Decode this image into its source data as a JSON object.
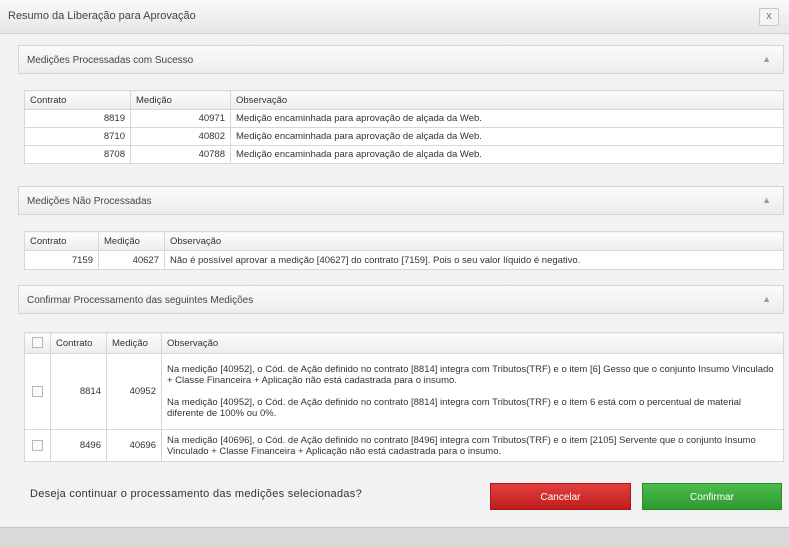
{
  "window": {
    "title": "Resumo da Liberação para Aprovação",
    "close_label": "x"
  },
  "sections": {
    "processed": {
      "title": "Medições Processadas com Sucesso"
    },
    "not_processed": {
      "title": "Medições Não Processadas"
    },
    "confirm": {
      "title": "Confirmar Processamento das seguintes Medições"
    }
  },
  "processed_table": {
    "headers": {
      "contrato": "Contrato",
      "medicao": "Medição",
      "observacao": "Observação"
    },
    "rows": [
      {
        "contrato": "8819",
        "medicao": "40971",
        "observacao": "Medição encaminhada para aprovação de alçada da Web."
      },
      {
        "contrato": "8710",
        "medicao": "40802",
        "observacao": "Medição encaminhada para aprovação de alçada da Web."
      },
      {
        "contrato": "8708",
        "medicao": "40788",
        "observacao": "Medição encaminhada para aprovação de alçada da Web."
      }
    ]
  },
  "not_processed_table": {
    "headers": {
      "contrato": "Contrato",
      "medicao": "Medição",
      "observacao": "Observação"
    },
    "rows": [
      {
        "contrato": "7159",
        "medicao": "40627",
        "observacao": "Não é possível aprovar a medição [40627] do contrato [7159]. Pois o seu valor líquido é negativo."
      }
    ]
  },
  "confirm_table": {
    "headers": {
      "contrato": "Contrato",
      "medicao": "Medição",
      "observacao": "Observação"
    },
    "rows": [
      {
        "contrato": "8814",
        "medicao": "40952",
        "checked": false,
        "obs1": "Na medição [40952], o Cód. de Ação definido no contrato [8814] integra com Tributos(TRF) e o item [6] Gesso que o conjunto Insumo Vinculado + Classe Financeira + Aplicação não está cadastrada para o insumo.",
        "obs2": "Na medição [40952], o Cód. de Ação definido no contrato [8814] integra com Tributos(TRF) e o item 6 está com o percentual de material diferente de 100% ou 0%."
      },
      {
        "contrato": "8496",
        "medicao": "40696",
        "checked": false,
        "obs1": "Na medição [40696], o Cód. de Ação definido no contrato [8496] integra com Tributos(TRF) e o item [2105] Servente que o conjunto Insumo Vinculado + Classe Financeira + Aplicação não está cadastrada para o insumo."
      }
    ]
  },
  "question": "Deseja continuar o processamento das medições selecionadas?",
  "buttons": {
    "cancel": "Cancelar",
    "confirm": "Confirmar"
  },
  "colors": {
    "cancel": "#d42e2e",
    "confirm": "#3fad3f"
  },
  "icons": {
    "collapse": "chevron-up-icon",
    "close": "close-icon",
    "checkbox": "checkbox-icon"
  }
}
